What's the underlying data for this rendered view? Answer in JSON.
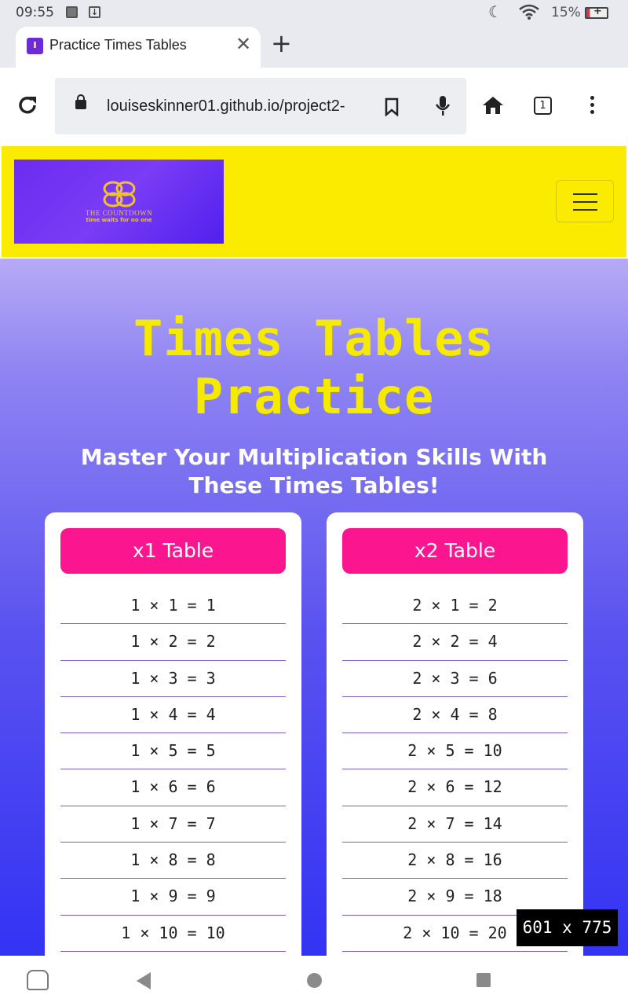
{
  "status_bar": {
    "time": "09:55",
    "battery": "15%"
  },
  "browser": {
    "tab_title": "Practice Times Tables",
    "url": "louiseskinner01.github.io/project2-",
    "tab_count": "1"
  },
  "site": {
    "logo_name": "THE COUNTDOWN",
    "logo_tagline": "time waits for no one",
    "title_line1": "Times Tables",
    "title_line2": "Practice",
    "subtitle": "Master Your Multiplication Skills With These Times Tables!"
  },
  "tables": [
    {
      "heading": "x1 Table",
      "rows": [
        "1 × 1 = 1",
        "1 × 2 = 2",
        "1 × 3 = 3",
        "1 × 4 = 4",
        "1 × 5 = 5",
        "1 × 6 = 6",
        "1 × 7 = 7",
        "1 × 8 = 8",
        "1 × 9 = 9",
        "1 × 10 = 10"
      ]
    },
    {
      "heading": "x2 Table",
      "rows": [
        "2 × 1 = 2",
        "2 × 2 = 4",
        "2 × 3 = 6",
        "2 × 4 = 8",
        "2 × 5 = 10",
        "2 × 6 = 12",
        "2 × 7 = 14",
        "2 × 8 = 16",
        "2 × 9 = 18",
        "2 × 10 = 20"
      ]
    }
  ],
  "viewport_badge": "601  x  775",
  "colors": {
    "nav_yellow": "#fbeb00",
    "title_yellow": "#f6ea00",
    "table_pink": "#fb1690",
    "logo_purple": "#6b2cf0"
  }
}
